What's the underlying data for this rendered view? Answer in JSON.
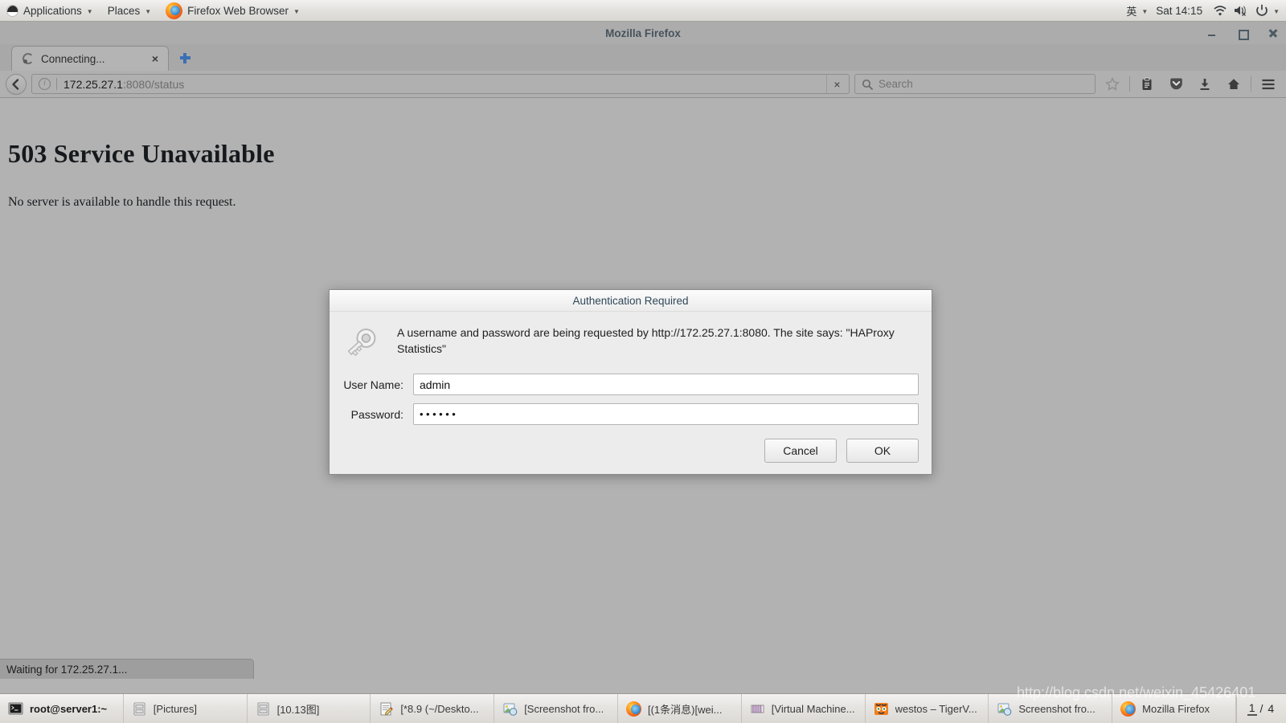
{
  "panel": {
    "applications": "Applications",
    "places": "Places",
    "firefox_menu": "Firefox Web Browser",
    "language": "英",
    "clock": "Sat 14:15",
    "icons": {
      "fedora": "fedora-logo-icon",
      "firefox": "firefox-icon",
      "wifi": "wifi-icon",
      "volume_muted": "volume-muted-icon",
      "power": "power-icon"
    }
  },
  "window": {
    "title": "Mozilla Firefox",
    "controls": {
      "minimize": "minimize-button",
      "maximize": "maximize-button",
      "close": "close-button"
    }
  },
  "tabs": {
    "items": [
      {
        "label": "Connecting...",
        "close": "×"
      }
    ],
    "new_tab": "+"
  },
  "navbar": {
    "back": "back-button",
    "url_host": "172.25.27.1",
    "url_rest": ":8080/status",
    "stop": "×",
    "search_placeholder": "Search",
    "icons": [
      "bookmark-star-icon",
      "reader-list-icon",
      "pocket-icon",
      "downloads-icon",
      "home-icon",
      "menu-icon"
    ]
  },
  "page": {
    "heading": "503 Service Unavailable",
    "body": "No server is available to handle this request."
  },
  "dialog": {
    "title": "Authentication Required",
    "message": "A username and password are being requested by http://172.25.27.1:8080. The site says: \"HAProxy Statistics\"",
    "username_label": "User Name:",
    "username_value": "admin",
    "password_label": "Password:",
    "password_value": "••••••",
    "cancel_label": "Cancel",
    "ok_label": "OK",
    "icon": "key-icon"
  },
  "status": {
    "text": "Waiting for 172.25.27.1..."
  },
  "taskbar": {
    "items": [
      {
        "label": "root@server1:~",
        "icon": "terminal-icon",
        "active": true
      },
      {
        "label": "[Pictures]",
        "icon": "file-manager-icon",
        "active": false
      },
      {
        "label": "[10.13图]",
        "icon": "file-manager-icon",
        "active": false
      },
      {
        "label": "[*8.9 (~/Deskto...",
        "icon": "text-editor-icon",
        "active": false
      },
      {
        "label": "[Screenshot fro...",
        "icon": "image-viewer-icon",
        "active": false
      },
      {
        "label": "[(1条消息)[wei...",
        "icon": "firefox-icon",
        "active": false
      },
      {
        "label": "[Virtual Machine...",
        "icon": "virt-manager-icon",
        "active": false
      },
      {
        "label": "westos – TigerV...",
        "icon": "tigervnc-icon",
        "active": false
      },
      {
        "label": "Screenshot fro...",
        "icon": "image-viewer-icon",
        "active": false
      },
      {
        "label": "Mozilla Firefox",
        "icon": "firefox-icon",
        "active": false
      }
    ],
    "workspace_current": "1",
    "workspace_sep": "/",
    "workspace_total": "4"
  },
  "watermark": {
    "text": "http://blog.csdn.net/weixin_45426401"
  },
  "colors": {
    "panel": "#e3e1de",
    "window_chrome": "#b0b0b0",
    "page_bg": "#b2b2b2",
    "dialog_bg": "#ececec",
    "accent_blue": "#3b6fb5"
  }
}
